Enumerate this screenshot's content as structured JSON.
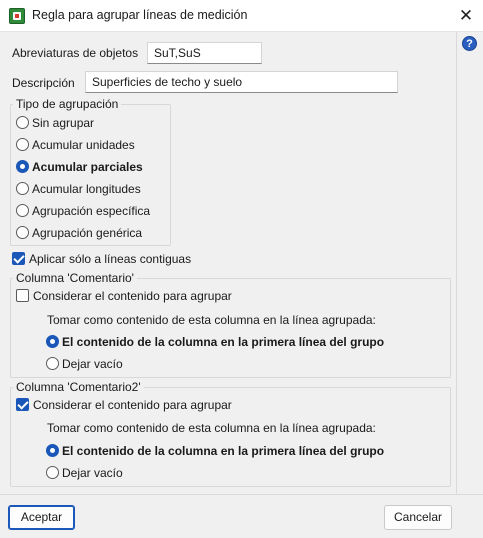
{
  "window": {
    "title": "Regla para agrupar líneas de medición",
    "close_symbol": "✕",
    "help_symbol": "?"
  },
  "fields": {
    "abbreviations_label": "Abreviaturas de objetos",
    "abbreviations_value": "SuT,SuS",
    "description_label": "Descripción",
    "description_value": "Superficies de techo y suelo"
  },
  "grouping": {
    "title": "Tipo de agrupación",
    "options": [
      {
        "label": "Sin agrupar",
        "selected": false
      },
      {
        "label": "Acumular unidades",
        "selected": false
      },
      {
        "label": "Acumular parciales",
        "selected": true
      },
      {
        "label": "Acumular longitudes",
        "selected": false
      },
      {
        "label": "Agrupación específica",
        "selected": false
      },
      {
        "label": "Agrupación genérica",
        "selected": false
      }
    ]
  },
  "contiguous": {
    "label": "Aplicar sólo a líneas contiguas",
    "checked": true
  },
  "comment1": {
    "title": "Columna 'Comentario'",
    "consider_label": "Considerar el contenido para agrupar",
    "consider_checked": false,
    "instruction": "Tomar como contenido de esta columna en la línea agrupada:",
    "option_first": "El contenido de la columna en la primera línea del grupo",
    "option_empty": "Dejar vacío",
    "selected": "first"
  },
  "comment2": {
    "title": "Columna 'Comentario2'",
    "consider_label": "Considerar el contenido para agrupar",
    "consider_checked": true,
    "instruction": "Tomar como contenido de esta columna en la línea agrupada:",
    "option_first": "El contenido de la columna en la primera línea del grupo",
    "option_empty": "Dejar vacío",
    "selected": "first"
  },
  "buttons": {
    "accept": "Aceptar",
    "cancel": "Cancelar"
  },
  "colors": {
    "accent": "#1a57b8",
    "background": "#f0f0f0"
  }
}
